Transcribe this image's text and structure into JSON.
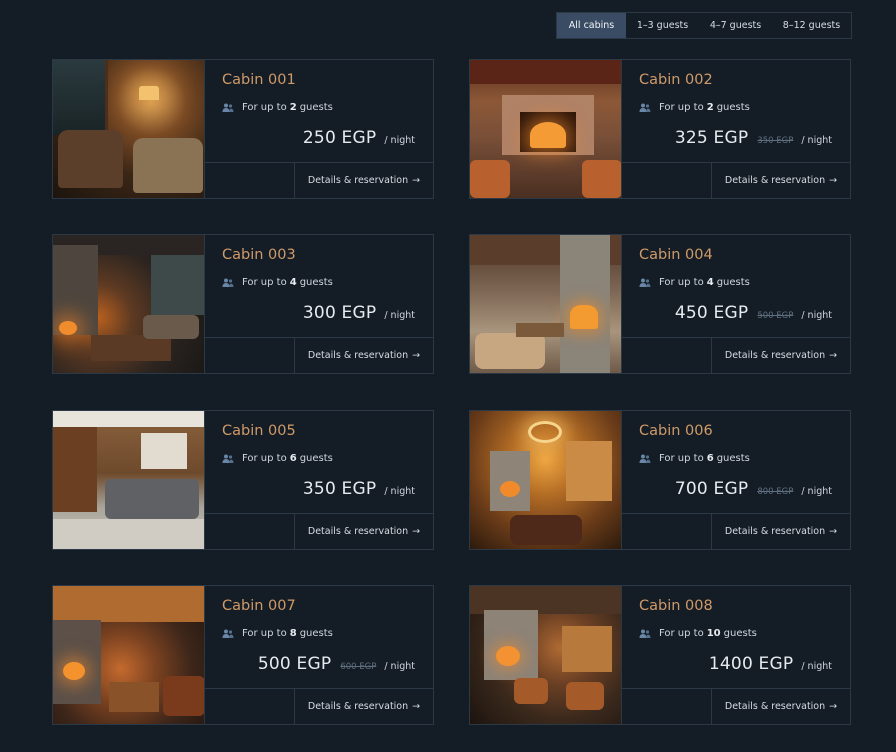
{
  "filters": [
    {
      "label": "All cabins",
      "active": true
    },
    {
      "label": "1–3 guests",
      "active": false
    },
    {
      "label": "4–7 guests",
      "active": false
    },
    {
      "label": "8–12 guests",
      "active": false
    }
  ],
  "labels": {
    "guests_prefix": "For up to",
    "guests_suffix": "guests",
    "per_night": "/ night",
    "details": "Details & reservation",
    "arrow": "→"
  },
  "cabins": [
    {
      "name": "Cabin 001",
      "guests": "2",
      "price": "250 EGP",
      "old_price": "",
      "photo": "cozy-reading-nook-with-lamp"
    },
    {
      "name": "Cabin 002",
      "guests": "2",
      "price": "325 EGP",
      "old_price": "350 EGP",
      "photo": "stone-fireplace-with-chandelier"
    },
    {
      "name": "Cabin 003",
      "guests": "4",
      "price": "300 EGP",
      "old_price": "",
      "photo": "dark-cabin-living-room-with-lights"
    },
    {
      "name": "Cabin 004",
      "guests": "4",
      "price": "450 EGP",
      "old_price": "500 EGP",
      "photo": "stone-fireplace-living-room"
    },
    {
      "name": "Cabin 005",
      "guests": "6",
      "price": "350 EGP",
      "old_price": "",
      "photo": "wood-paneled-room-with-sofa"
    },
    {
      "name": "Cabin 006",
      "guests": "6",
      "price": "700 EGP",
      "old_price": "800 EGP",
      "photo": "log-lodge-with-antler-chandelier"
    },
    {
      "name": "Cabin 007",
      "guests": "8",
      "price": "500 EGP",
      "old_price": "600 EGP",
      "photo": "wooden-lodge-with-fireplace"
    },
    {
      "name": "Cabin 008",
      "guests": "10",
      "price": "1400 EGP",
      "old_price": "",
      "photo": "rustic-lodge-with-stone-hearth"
    }
  ]
}
